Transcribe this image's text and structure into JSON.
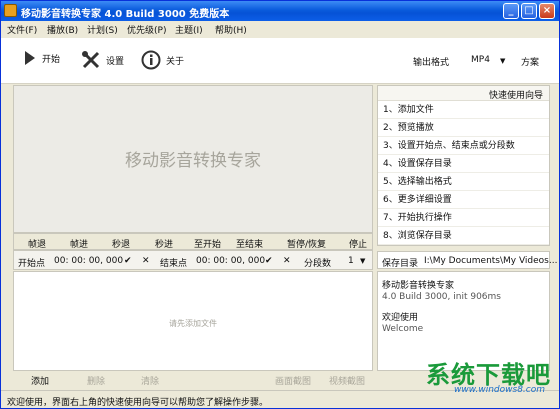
{
  "window": {
    "title": "移动影音转换专家 4.0 Build 3000 免费版本"
  },
  "menu": [
    "文件(F)",
    "播放(B)",
    "计划(S)",
    "优先级(P)",
    "主题(I)",
    "帮助(H)"
  ],
  "toolbar": {
    "start_label": "开始",
    "settings_label": "设置",
    "about_label": "关于",
    "output_format_label": "输出格式",
    "output_format_value": "MP4",
    "profile_label": "方案"
  },
  "preview": {
    "watermark": "移动影音转换专家"
  },
  "nav_buttons": [
    "帧退",
    "帧进",
    "秒退",
    "秒进",
    "至开始",
    "至结束",
    "暂停/恢复",
    "停止"
  ],
  "clip": {
    "start_label": "开始点",
    "start_time": "00: 00: 00, 000",
    "end_label": "结束点",
    "end_time": "00: 00: 00, 000",
    "segments_label": "分段数",
    "segments_value": "1"
  },
  "file_list": {
    "placeholder": "请先添加文件"
  },
  "bottom_buttons": {
    "add": "添加",
    "delete": "删除",
    "clear": "清除",
    "screenshot": "画面截图",
    "video_shot": "视频截图"
  },
  "guide": {
    "header": "快速使用向导",
    "items": [
      "1、添加文件",
      "2、预览播放",
      "3、设置开始点、结束点或分段数",
      "4、设置保存目录",
      "5、选择输出格式",
      "6、更多详细设置",
      "7、开始执行操作",
      "8、浏览保存目录"
    ]
  },
  "save_dir": {
    "label": "保存目录",
    "path": "I:\\My Documents\\My Videos..."
  },
  "info": {
    "app_name": "移动影音转换专家",
    "version": "4.0 Build 3000, init 906ms",
    "welcome_title": "欢迎使用",
    "welcome_sub": "Welcome"
  },
  "status": {
    "text": "欢迎使用，界面右上角的快速使用向导可以帮助您了解操作步骤。"
  },
  "watermark_logo": {
    "text": "系统下载吧",
    "url": "www.windows8.com"
  }
}
